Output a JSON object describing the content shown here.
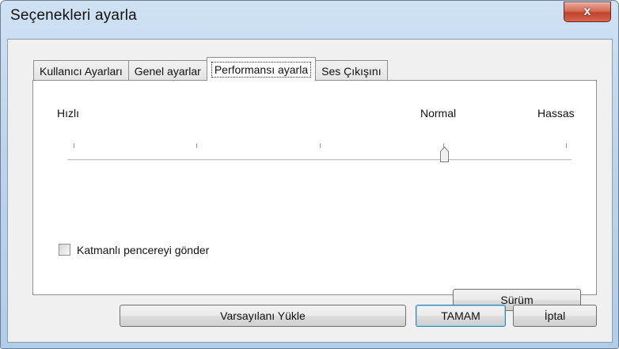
{
  "window": {
    "title": "Seçenekleri ayarla",
    "close_label": "x"
  },
  "tabs": [
    {
      "label": "Kullanıcı Ayarları",
      "active": false
    },
    {
      "label": "Genel ayarlar",
      "active": false
    },
    {
      "label": "Performansı ayarla",
      "active": true
    },
    {
      "label": "Ses Çıkışını",
      "active": false
    }
  ],
  "performance": {
    "slider_labels": {
      "left": "Hızlı",
      "middle": "Normal",
      "right": "Hassas"
    },
    "slider_tick_count": 5,
    "slider_value_index": 3,
    "checkbox_label": "Katmanlı pencereyi gönder",
    "checkbox_checked": false,
    "version_button": "Sürüm"
  },
  "footer": {
    "load_defaults": "Varsayılanı Yükle",
    "ok": "TAMAM",
    "cancel": "İptal"
  },
  "colors": {
    "close_red": "#c0432b",
    "default_button_border": "#3c7fb1",
    "frame_blue": "#b9d1ea"
  }
}
